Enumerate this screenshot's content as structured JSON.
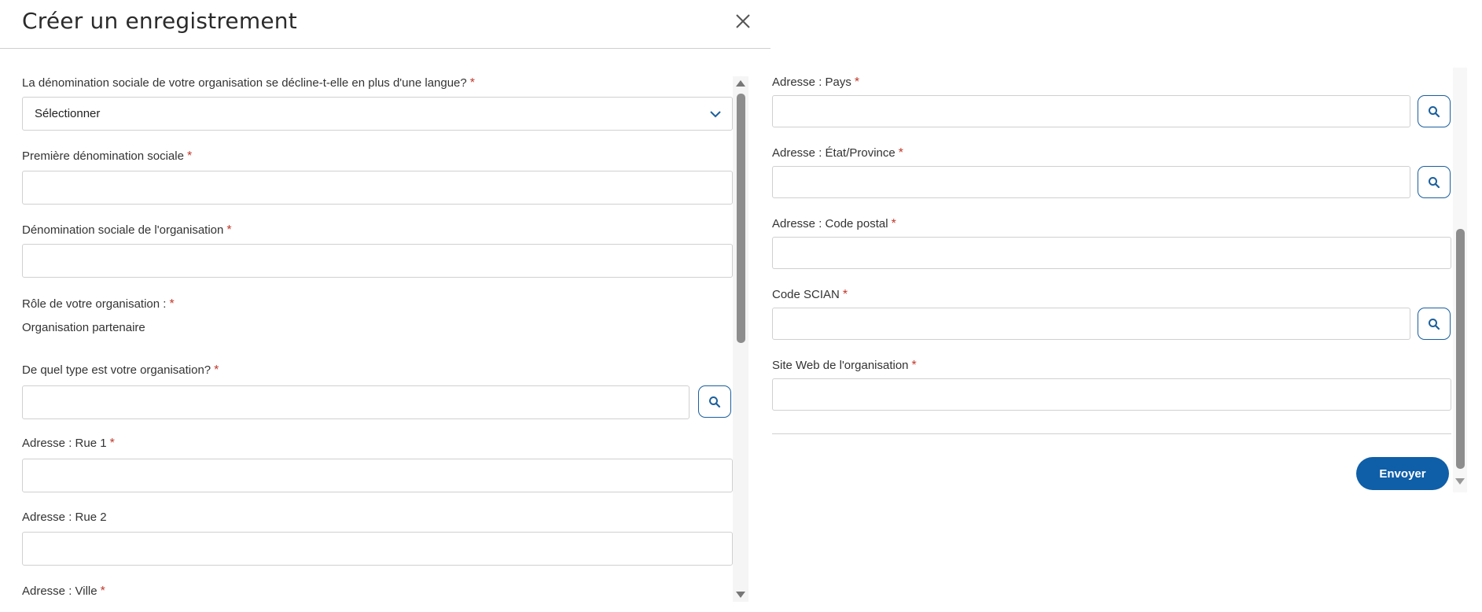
{
  "dialog": {
    "title": "Créer un enregistrement",
    "close_icon": "close-icon"
  },
  "left_form": {
    "fields": [
      {
        "label": "La dénomination sociale de votre organisation se décline-t-elle en plus d'une langue?",
        "required": "*",
        "type": "select",
        "value": "Sélectionner"
      },
      {
        "label": "Première dénomination sociale",
        "required": "*",
        "type": "text",
        "value": ""
      },
      {
        "label": "Dénomination sociale de l'organisation",
        "required": "*",
        "type": "text",
        "value": ""
      },
      {
        "label": "Rôle de votre organisation :",
        "required": "*",
        "type": "static",
        "value": "Organisation partenaire"
      },
      {
        "label": "De quel type est votre organisation?",
        "required": "*",
        "type": "lookup",
        "value": ""
      },
      {
        "label": "Adresse : Rue 1",
        "required": "*",
        "type": "text",
        "value": ""
      },
      {
        "label": "Adresse : Rue 2",
        "required": "",
        "type": "text",
        "value": ""
      },
      {
        "label": "Adresse : Ville",
        "required": "*",
        "type": "text",
        "value": ""
      }
    ]
  },
  "right_form": {
    "fields": [
      {
        "label": "Adresse : Pays",
        "required": "*",
        "type": "lookup",
        "value": ""
      },
      {
        "label": "Adresse : État/Province",
        "required": "*",
        "type": "lookup",
        "value": ""
      },
      {
        "label": "Adresse : Code postal",
        "required": "*",
        "type": "text",
        "value": ""
      },
      {
        "label": "Code SCIAN",
        "required": "*",
        "type": "lookup",
        "value": ""
      },
      {
        "label": "Site Web de l'organisation",
        "required": "*",
        "type": "text",
        "value": ""
      }
    ],
    "submit_label": "Envoyer"
  },
  "icons": {
    "search": "search-icon",
    "chevron": "chevron-down-icon",
    "scroll_up": "scroll-up-arrow-icon",
    "scroll_down": "scroll-down-arrow-icon"
  },
  "colors": {
    "accent": "#0f5ea8",
    "required": "#c0392b",
    "border": "#d0d0d0",
    "scroll_thumb": "#8d8d8d"
  }
}
